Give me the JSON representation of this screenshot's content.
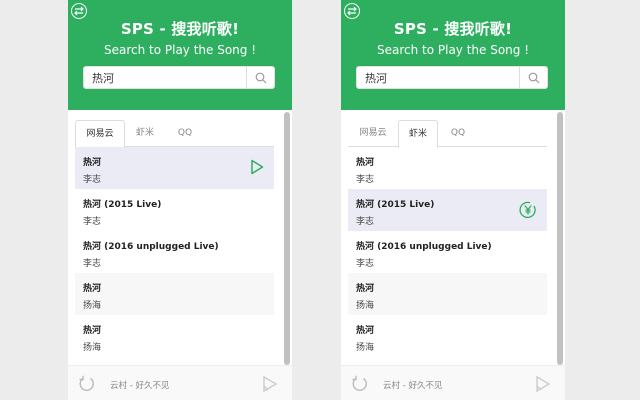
{
  "header": {
    "title": "SPS - 搜我听歌!",
    "subtitle": "Search to Play the Song !"
  },
  "search": {
    "value": "热河"
  },
  "tabs": [
    "网易云",
    "虾米",
    "QQ"
  ],
  "panels": [
    {
      "active_tab": "网易云",
      "songs": [
        {
          "name": "热河",
          "artist": "李志",
          "action": "play-icon"
        },
        {
          "name": "热河 (2015 Live)",
          "artist": "李志"
        },
        {
          "name": "热河 (2016 unplugged Live)",
          "artist": "李志"
        },
        {
          "name": "热河",
          "artist": "扬海"
        },
        {
          "name": "热河",
          "artist": "扬海"
        }
      ]
    },
    {
      "active_tab": "虾米",
      "songs": [
        {
          "name": "热河",
          "artist": "李志"
        },
        {
          "name": "热河 (2015 Live)",
          "artist": "李志",
          "action": "yen-coin-icon"
        },
        {
          "name": "热河 (2016 unplugged Live)",
          "artist": "李志"
        },
        {
          "name": "热河",
          "artist": "扬海"
        },
        {
          "name": "热河",
          "artist": "扬海"
        }
      ]
    }
  ],
  "footer": {
    "now_playing": "云村 - 好久不见"
  },
  "colors": {
    "brand": "#2daf5f",
    "highlight_row": "#ebebf5"
  }
}
